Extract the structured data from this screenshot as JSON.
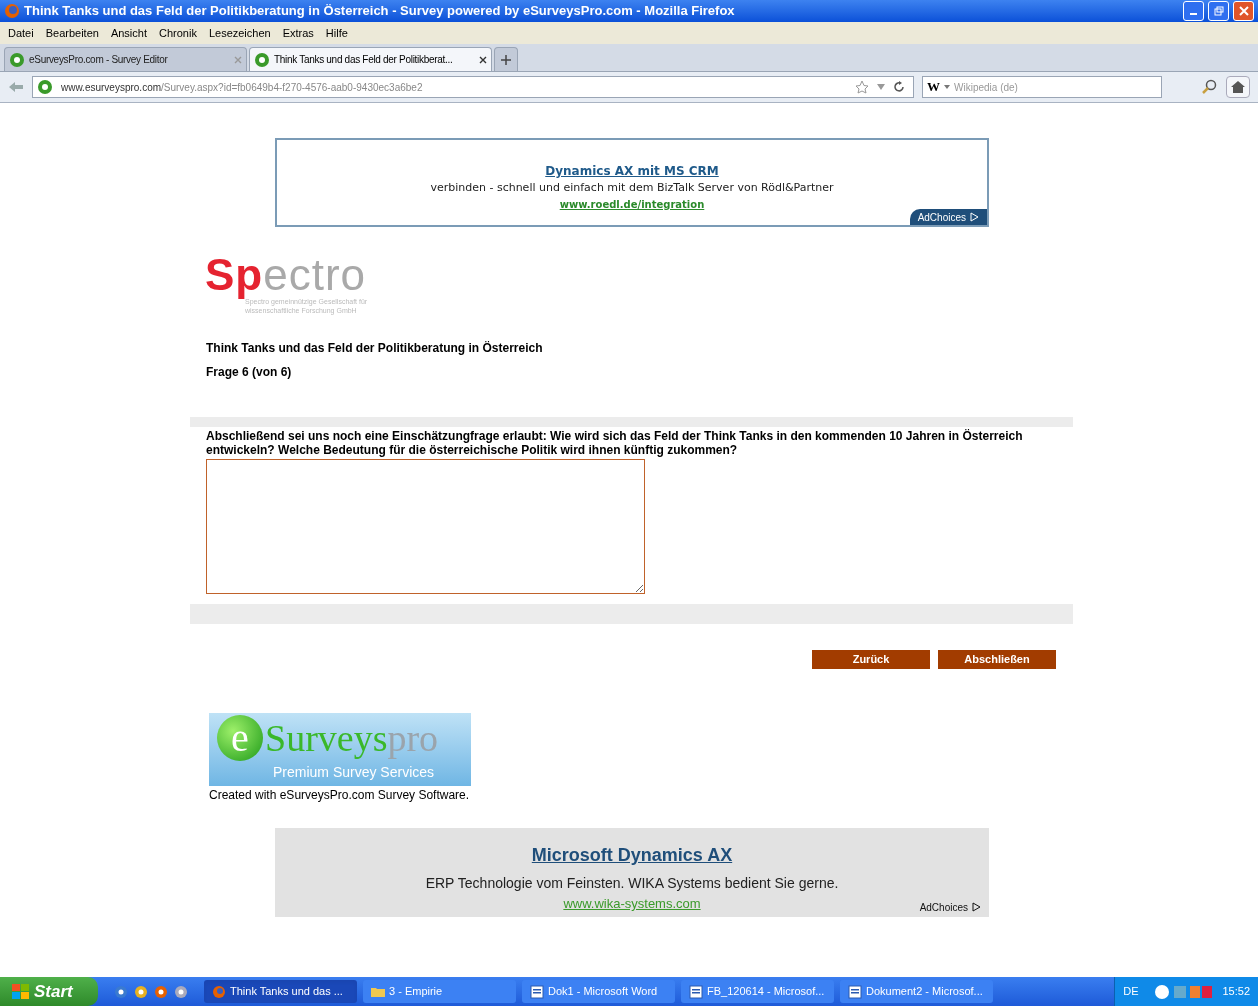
{
  "window": {
    "title": "Think Tanks und das Feld der Politikberatung in Österreich - Survey powered by eSurveysPro.com - Mozilla Firefox"
  },
  "menu": [
    "Datei",
    "Bearbeiten",
    "Ansicht",
    "Chronik",
    "Lesezeichen",
    "Extras",
    "Hilfe"
  ],
  "tabs": [
    {
      "label": "eSurveysPro.com - Survey Editor",
      "selected": false
    },
    {
      "label": "Think Tanks und das Feld der Politikberat...",
      "selected": true
    }
  ],
  "address_bar": {
    "host": "www.esurveyspro.com",
    "path": "/Survey.aspx?id=fb0649b4-f270-4576-aab0-9430ec3a6be2",
    "search_engine": "W",
    "search_placeholder": "Wikipedia (de)"
  },
  "top_ad": {
    "title": "Dynamics AX mit MS CRM",
    "text": "verbinden - schnell und einfach mit dem BizTalk Server von Rödl&Partner",
    "url": "www.roedl.de/integration",
    "adchoices": "AdChoices"
  },
  "logo": {
    "accent": "Sp",
    "rest": "ectro",
    "tagline": "Spectro gemeinnützige Gesellschaft für wissenschaftliche Forschung GmbH"
  },
  "survey": {
    "title": "Think Tanks und das Feld der Politikberatung in Österreich",
    "progress": "Frage 6 (von 6)",
    "question": "Abschließend sei uns noch eine Einschätzungfrage erlaubt: Wie wird sich das Feld der Think Tanks in den kommenden 10 Jahren in Österreich entwickeln? Welche Bedeutung für die österreichische Politik wird ihnen künftig zukommen?"
  },
  "buttons": [
    "Zurück",
    "Abschließen"
  ],
  "footer_logo": {
    "initial": "e",
    "brand": "Surveys",
    "brand_suffix": "pro",
    "slogan": "Premium Survey Services",
    "caption": "Created with eSurveysPro.com Survey Software."
  },
  "bottom_ad": {
    "title": "Microsoft Dynamics AX",
    "text": "ERP Technologie vom Feinsten. WIKA Systems bedient Sie gerne.",
    "url": "www.wika-systems.com",
    "adchoices": "AdChoices"
  },
  "taskbar": {
    "start": "Start",
    "tasks": [
      {
        "label": "Think Tanks und das ...",
        "selected": true,
        "kind": "browser"
      },
      {
        "label": "3 - Empirie",
        "selected": false,
        "kind": "folder"
      },
      {
        "label": "Dok1 - Microsoft Word",
        "selected": false,
        "kind": "document"
      },
      {
        "label": "FB_120614 - Microsof...",
        "selected": false,
        "kind": "document"
      },
      {
        "label": "Dokument2 - Microsof...",
        "selected": false,
        "kind": "document"
      }
    ],
    "language": "DE",
    "clock": "15:52"
  }
}
